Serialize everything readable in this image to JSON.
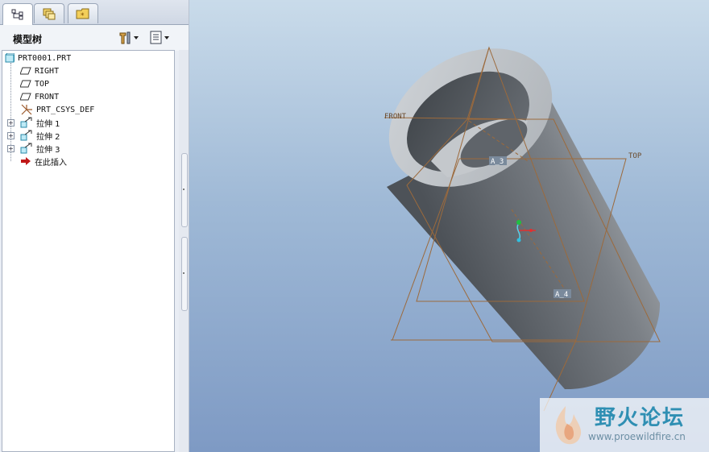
{
  "tabs": [
    {
      "icon": "model-tree-icon",
      "active": true
    },
    {
      "icon": "layers-icon",
      "active": false
    },
    {
      "icon": "favorites-folder-icon",
      "active": false
    }
  ],
  "panel": {
    "title": "模型树"
  },
  "tree": {
    "root": "PRT0001.PRT",
    "items": [
      {
        "label": "RIGHT",
        "icon": "datum-plane-icon",
        "expandable": false
      },
      {
        "label": "TOP",
        "icon": "datum-plane-icon",
        "expandable": false
      },
      {
        "label": "FRONT",
        "icon": "datum-plane-icon",
        "expandable": false
      },
      {
        "label": "PRT_CSYS_DEF",
        "icon": "coordinate-system-icon",
        "expandable": false
      },
      {
        "label": "拉伸 1",
        "icon": "extrude-icon",
        "expandable": true
      },
      {
        "label": "拉伸 2",
        "icon": "extrude-icon",
        "expandable": true
      },
      {
        "label": "拉伸 3",
        "icon": "extrude-icon",
        "expandable": true
      },
      {
        "label": "在此插入",
        "icon": "insert-here-arrow-icon",
        "expandable": false
      }
    ]
  },
  "viewport": {
    "labels": {
      "front": "FRONT",
      "top": "TOP",
      "axis_a3": "A_3",
      "axis_a4": "A_4"
    },
    "colors": {
      "datum": "#9c6a3c",
      "csys_x": "#e03030",
      "csys_y": "#20c040",
      "csys_z": "#30c0e0"
    }
  },
  "watermark": {
    "title": "野火论坛",
    "url": "www.proewildfire.cn"
  }
}
